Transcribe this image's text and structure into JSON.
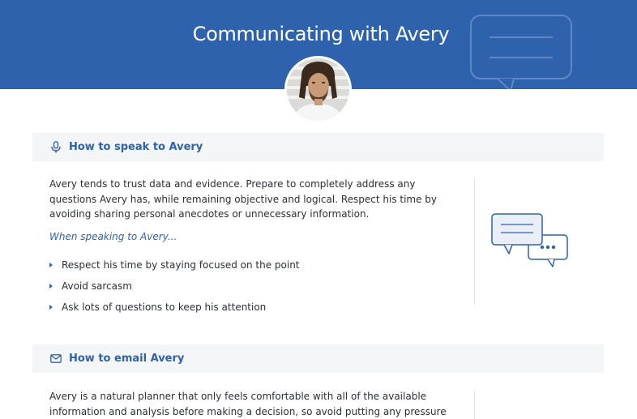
{
  "header": {
    "title": "Communicating with Avery",
    "icons": {
      "decoration": "speech-bubble-icon"
    }
  },
  "avatar": {
    "alt": "Avery"
  },
  "sections": [
    {
      "title": "How to speak to Avery",
      "icon": "microphone-icon",
      "body": "Avery tends to trust data and evidence. Prepare to completely address any questions Avery has, while remaining objective and logical. Respect his time by avoiding sharing personal anecdotes or unnecessary information.",
      "lead": "When speaking to Avery...",
      "bullets": [
        "Respect his time by staying focused on the point",
        "Avoid sarcasm",
        "Ask lots of questions to keep his attention"
      ],
      "illustration": "chat-bubbles-icon"
    },
    {
      "title": "How to email Avery",
      "icon": "envelope-icon",
      "body": "Avery is a natural planner that only feels comfortable with all of the available information and analysis before making a decision, so avoid putting any pressure after reaching out and give"
    }
  ],
  "colors": {
    "brand": "#2f62ad",
    "section_bg": "#f4f5f7",
    "text": "#2b2f36"
  }
}
